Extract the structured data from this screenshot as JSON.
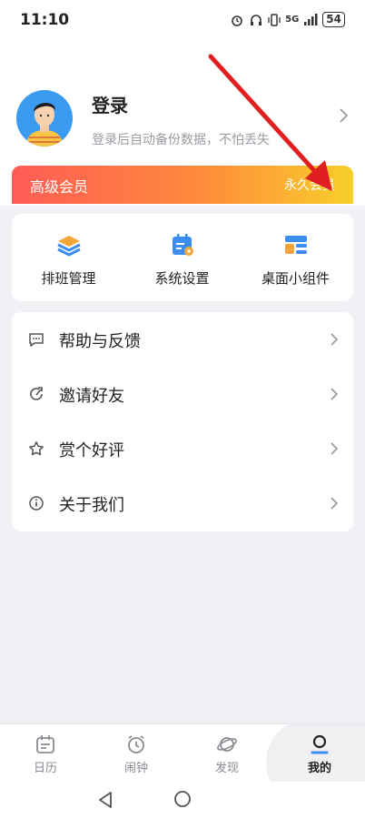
{
  "status_bar": {
    "time": "11:10",
    "network": "5G",
    "battery": "54"
  },
  "profile": {
    "title": "登录",
    "subtitle": "登录后自动备份数据，不怕丢失"
  },
  "vip": {
    "label": "高级会员",
    "badge": "永久会员",
    "gradient_start": "#ff5c55",
    "gradient_end": "#f7cf2a"
  },
  "shortcuts": [
    {
      "label": "排班管理",
      "icon": "layers-icon"
    },
    {
      "label": "系统设置",
      "icon": "calendar-settings-icon"
    },
    {
      "label": "桌面小组件",
      "icon": "widget-icon"
    }
  ],
  "menu": [
    {
      "label": "帮助与反馈",
      "icon": "message-icon"
    },
    {
      "label": "邀请好友",
      "icon": "share-icon"
    },
    {
      "label": "赏个好评",
      "icon": "star-icon"
    },
    {
      "label": "关于我们",
      "icon": "info-icon"
    }
  ],
  "tabs": [
    {
      "label": "日历",
      "icon": "calendar-icon"
    },
    {
      "label": "闹钟",
      "icon": "alarm-icon"
    },
    {
      "label": "发现",
      "icon": "planet-icon"
    },
    {
      "label": "我的",
      "icon": "user-icon",
      "active": true
    }
  ],
  "colors": {
    "accent_blue": "#3b8ef0",
    "arrow_red": "#e02020"
  }
}
